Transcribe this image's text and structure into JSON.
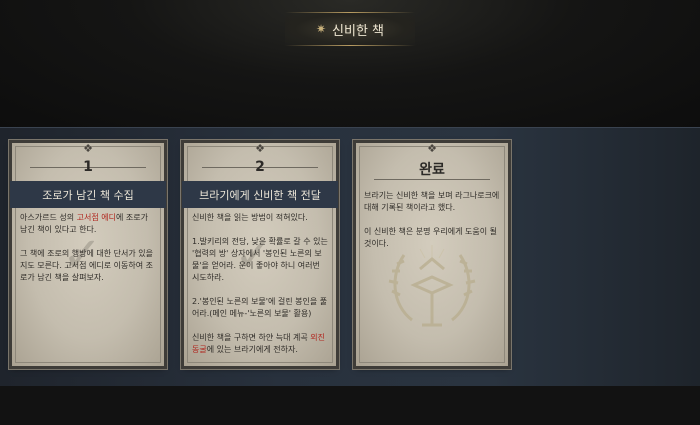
{
  "title": {
    "icon": "compass-star-icon",
    "text": "신비한 책"
  },
  "cards": [
    {
      "number": "1",
      "heading": "조로가 남긴 책 수집",
      "completed": true,
      "paragraphs": [
        {
          "pre": "아스가르드 성의 ",
          "highlight": "고서점 에디",
          "post": "에 조로가 남긴 책이 있다고 한다."
        },
        {
          "pre": "그 책에 조로의 행방에 대한 단서가 있을지도 모른다. 고서점 에디로 이동하여 조로가 남긴 책을 살펴보자.",
          "highlight": "",
          "post": ""
        }
      ]
    },
    {
      "number": "2",
      "heading": "브라기에게 신비한 책 전달",
      "completed": true,
      "paragraphs": [
        {
          "pre": "신비한 책을 읽는 방법이 적혀있다.",
          "highlight": "",
          "post": ""
        },
        {
          "pre": "1.발키리의 전당, 낮은 확률로 갈 수 있는 '협력의 방' 상자에서 '봉인된 노른의 보물'을 얻어라. 운이 좋아야 하니 여러번 시도하라.",
          "highlight": "",
          "post": ""
        },
        {
          "pre": "2.'봉인된 노른의 보물'에 걸린 봉인을 풀어라.(메인 메뉴-'노른의 보물' 활용)",
          "highlight": "",
          "post": ""
        },
        {
          "pre": "신비한 책을 구하면 하얀 늑대 계곡 ",
          "highlight": "외진 동굴",
          "post": "에 있는 브라기에게 전하자."
        }
      ]
    }
  ],
  "complete_card": {
    "title": "완료",
    "paragraphs": [
      "브라기는 신비한 책을 보며 라그나로크에 대해 기록된 책이라고 했다.",
      "이 신비한 책은 분명 우리에게 도움이 될 것이다."
    ],
    "emblem": "laurel-book-emblem-icon"
  },
  "colors": {
    "accent_red": "#b0261e",
    "header_navy": "#2e3847",
    "parchment": "#c9c2b3"
  }
}
